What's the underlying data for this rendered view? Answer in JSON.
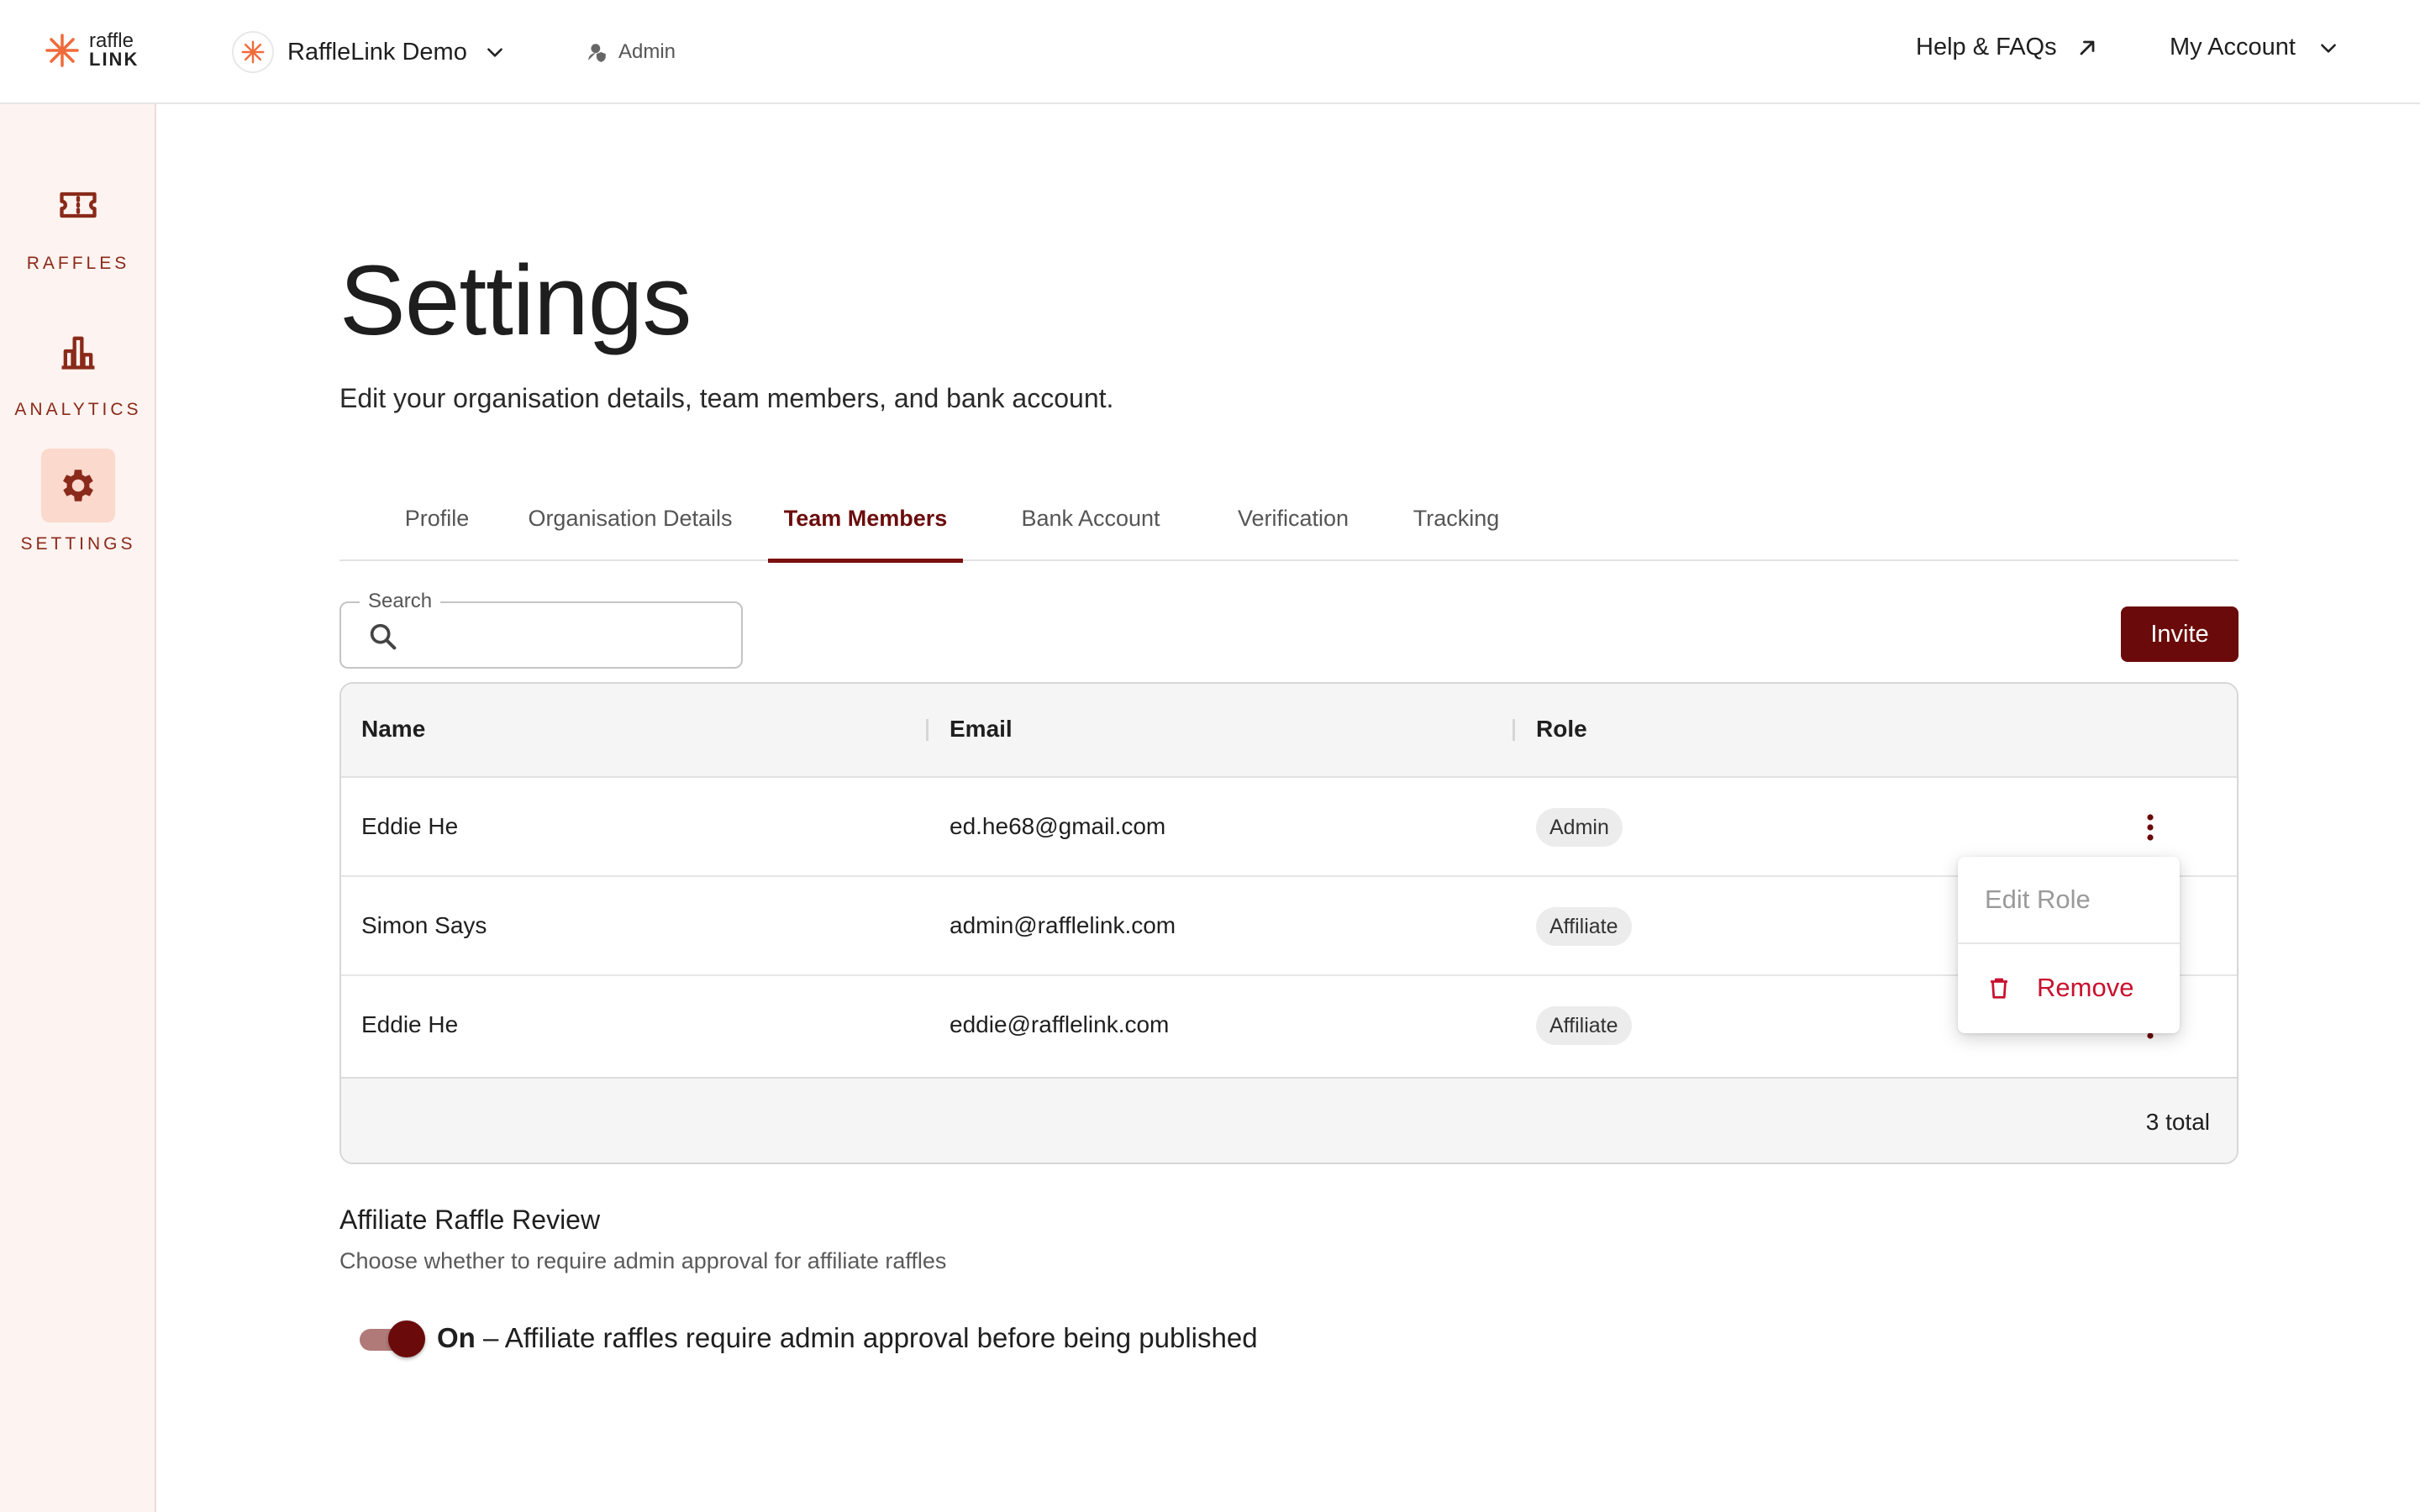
{
  "brand": {
    "logo_line1": "raffle",
    "logo_line2": "LINK",
    "accent": "#ef6b3a",
    "primary": "#6b0a0a"
  },
  "header": {
    "org_name": "RaffleLink Demo",
    "role": "Admin",
    "help_label": "Help & FAQs",
    "account_label": "My Account"
  },
  "sidebar": {
    "items": [
      {
        "label": "RAFFLES",
        "icon": "ticket-icon",
        "active": false
      },
      {
        "label": "ANALYTICS",
        "icon": "bar-chart-icon",
        "active": false
      },
      {
        "label": "SETTINGS",
        "icon": "gear-icon",
        "active": true
      }
    ]
  },
  "page": {
    "title": "Settings",
    "subtitle": "Edit your organisation details, team members, and bank account."
  },
  "tabs": [
    {
      "label": "Profile",
      "active": false
    },
    {
      "label": "Organisation Details",
      "active": false
    },
    {
      "label": "Team Members",
      "active": true
    },
    {
      "label": "Bank Account",
      "active": false
    },
    {
      "label": "Verification",
      "active": false
    },
    {
      "label": "Tracking",
      "active": false
    }
  ],
  "search": {
    "label": "Search",
    "value": ""
  },
  "invite_label": "Invite",
  "table": {
    "columns": [
      "Name",
      "Email",
      "Role"
    ],
    "rows": [
      {
        "name": "Eddie He",
        "email": "ed.he68@gmail.com",
        "role": "Admin"
      },
      {
        "name": "Simon Says",
        "email": "admin@rafflelink.com",
        "role": "Affiliate"
      },
      {
        "name": "Eddie He",
        "email": "eddie@rafflelink.com",
        "role": "Affiliate"
      }
    ],
    "total_label": "3 total"
  },
  "row_menu": {
    "edit_label": "Edit Role",
    "remove_label": "Remove"
  },
  "review": {
    "title": "Affiliate Raffle Review",
    "subtitle": "Choose whether to require admin approval for affiliate raffles",
    "toggle_on": true,
    "state_label": "On",
    "description": " – Affiliate raffles require admin approval before being published"
  }
}
